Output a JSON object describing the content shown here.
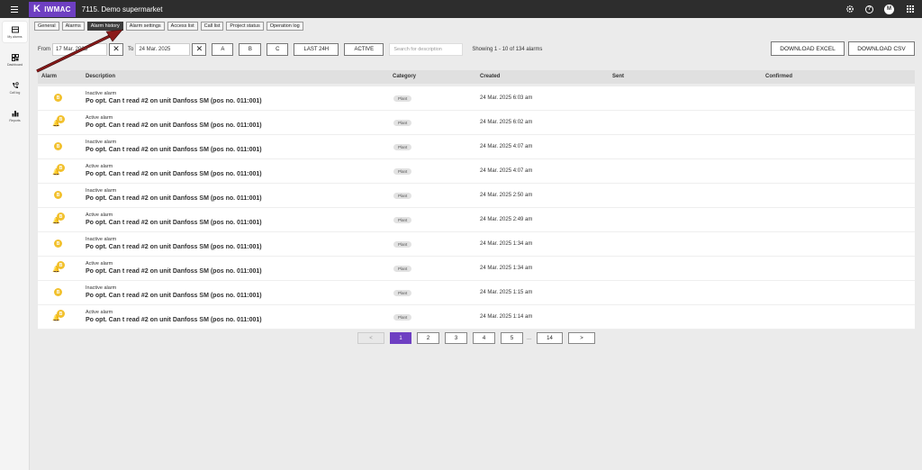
{
  "header": {
    "brand_mark": "K",
    "brand": "IWMAC",
    "site_title": "7115. Demo supermarket",
    "avatar_initial": "M"
  },
  "sidebar": {
    "items": [
      {
        "label": "My alarms",
        "icon": "alarm-list-icon"
      },
      {
        "label": "Dashboard",
        "icon": "dashboard-icon"
      },
      {
        "label": "Call log",
        "icon": "call-log-icon"
      },
      {
        "label": "Reports",
        "icon": "reports-icon"
      }
    ]
  },
  "tabs": [
    {
      "label": "General"
    },
    {
      "label": "Alarms"
    },
    {
      "label": "Alarm history"
    },
    {
      "label": "Alarm settings"
    },
    {
      "label": "Access list"
    },
    {
      "label": "Call list"
    },
    {
      "label": "Project status"
    },
    {
      "label": "Operation log"
    }
  ],
  "filters": {
    "from_label": "From",
    "from_value": "17 Mar. 2025",
    "to_label": "To",
    "to_value": "24 Mar. 2025",
    "btn_a": "A",
    "btn_b": "B",
    "btn_c": "C",
    "btn_last24": "LAST 24H",
    "btn_active": "ACTIVE",
    "search_placeholder": "Search for description",
    "showing": "Showing 1 - 10 of 134 alarms",
    "download_excel": "DOWNLOAD EXCEL",
    "download_csv": "DOWNLOAD CSV"
  },
  "table": {
    "headers": {
      "alarm": "Alarm",
      "description": "Description",
      "category": "Category",
      "created": "Created",
      "sent": "Sent",
      "confirmed": "Confirmed"
    },
    "rows": [
      {
        "type": "inactive",
        "badge": "B",
        "status": "Inactive alarm",
        "description": "Po opt. Can t read #2 on unit Danfoss SM (pos no. 011:001)",
        "category": "Plant",
        "created": "24 Mar. 2025 6:03 am"
      },
      {
        "type": "active",
        "badge": "B",
        "status": "Active alarm",
        "description": "Po opt. Can t read #2 on unit Danfoss SM (pos no. 011:001)",
        "category": "Plant",
        "created": "24 Mar. 2025 6:02 am"
      },
      {
        "type": "inactive",
        "badge": "B",
        "status": "Inactive alarm",
        "description": "Po opt. Can t read #2 on unit Danfoss SM (pos no. 011:001)",
        "category": "Plant",
        "created": "24 Mar. 2025 4:07 am"
      },
      {
        "type": "active",
        "badge": "B",
        "status": "Active alarm",
        "description": "Po opt. Can t read #2 on unit Danfoss SM (pos no. 011:001)",
        "category": "Plant",
        "created": "24 Mar. 2025 4:07 am"
      },
      {
        "type": "inactive",
        "badge": "B",
        "status": "Inactive alarm",
        "description": "Po opt. Can t read #2 on unit Danfoss SM (pos no. 011:001)",
        "category": "Plant",
        "created": "24 Mar. 2025 2:50 am"
      },
      {
        "type": "active",
        "badge": "B",
        "status": "Active alarm",
        "description": "Po opt. Can t read #2 on unit Danfoss SM (pos no. 011:001)",
        "category": "Plant",
        "created": "24 Mar. 2025 2:49 am"
      },
      {
        "type": "inactive",
        "badge": "B",
        "status": "Inactive alarm",
        "description": "Po opt. Can t read #2 on unit Danfoss SM (pos no. 011:001)",
        "category": "Plant",
        "created": "24 Mar. 2025 1:34 am"
      },
      {
        "type": "active",
        "badge": "B",
        "status": "Active alarm",
        "description": "Po opt. Can t read #2 on unit Danfoss SM (pos no. 011:001)",
        "category": "Plant",
        "created": "24 Mar. 2025 1:34 am"
      },
      {
        "type": "inactive",
        "badge": "B",
        "status": "Inactive alarm",
        "description": "Po opt. Can t read #2 on unit Danfoss SM (pos no. 011:001)",
        "category": "Plant",
        "created": "24 Mar. 2025 1:15 am"
      },
      {
        "type": "active",
        "badge": "B",
        "status": "Active alarm",
        "description": "Po opt. Can t read #2 on unit Danfoss SM (pos no. 011:001)",
        "category": "Plant",
        "created": "24 Mar. 2025 1:14 am"
      }
    ]
  },
  "pagination": {
    "prev": "<",
    "pages": [
      "1",
      "2",
      "3",
      "4",
      "5"
    ],
    "ellipsis": "...",
    "last": "14",
    "next": ">",
    "current": "1"
  },
  "colors": {
    "brand": "#6e3fc2",
    "topbar": "#2d2d2d",
    "alarm_b": "#f2c12e",
    "annotation_arrow": "#8b1a1a"
  }
}
